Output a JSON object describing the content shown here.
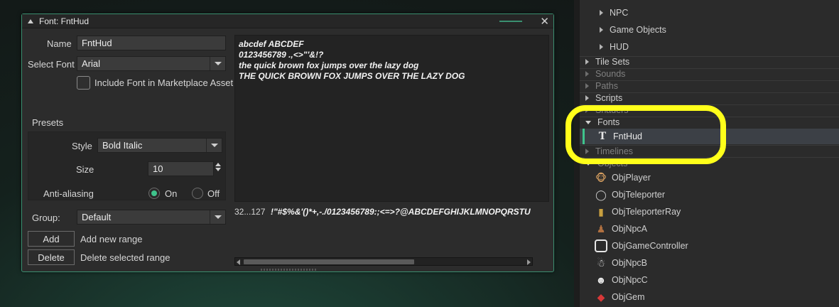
{
  "window": {
    "title": "Font: FntHud",
    "close_glyph": "✕"
  },
  "form": {
    "name_label": "Name",
    "name_value": "FntHud",
    "select_font_label": "Select Font",
    "select_font_value": "Arial",
    "include_font_label": "Include Font in Marketplace Asset",
    "presets_label": "Presets",
    "style_label": "Style",
    "style_value": "Bold Italic",
    "size_label": "Size",
    "size_value": "10",
    "antialiasing_label": "Anti-aliasing",
    "aa_on_label": "On",
    "aa_off_label": "Off",
    "group_label": "Group:",
    "group_value": "Default",
    "add_button": "Add",
    "add_desc": "Add new range",
    "delete_button": "Delete",
    "delete_desc": "Delete selected range"
  },
  "preview": {
    "lines": [
      "abcdef ABCDEF",
      "0123456789 .,<>\"'&!?",
      "the quick brown fox jumps over the lazy dog",
      "THE QUICK BROWN FOX JUMPS OVER THE LAZY DOG"
    ]
  },
  "range": {
    "label": "32...127",
    "chars": "!\"#$%&'()*+,-./0123456789:;<=>?@ABCDEFGHIJKLMNOPQRSTU"
  },
  "tree": {
    "npc": "NPC",
    "game_objects": "Game Objects",
    "hud": "HUD",
    "tile_sets": "Tile Sets",
    "sounds": "Sounds",
    "paths": "Paths",
    "scripts": "Scripts",
    "shaders": "Shaders",
    "fonts": "Fonts",
    "fnthud": "FntHud",
    "timelines": "Timelines",
    "objects": "Objects",
    "objects_list": [
      "ObjPlayer",
      "ObjTeleporter",
      "ObjTeleporterRay",
      "ObjNpcA",
      "ObjGameController",
      "ObjNpcB",
      "ObjNpcC",
      "ObjGem"
    ]
  },
  "colors": {
    "accent": "#3fc48c",
    "highlight": "#ffff1a",
    "window_border": "#3a8f70"
  }
}
